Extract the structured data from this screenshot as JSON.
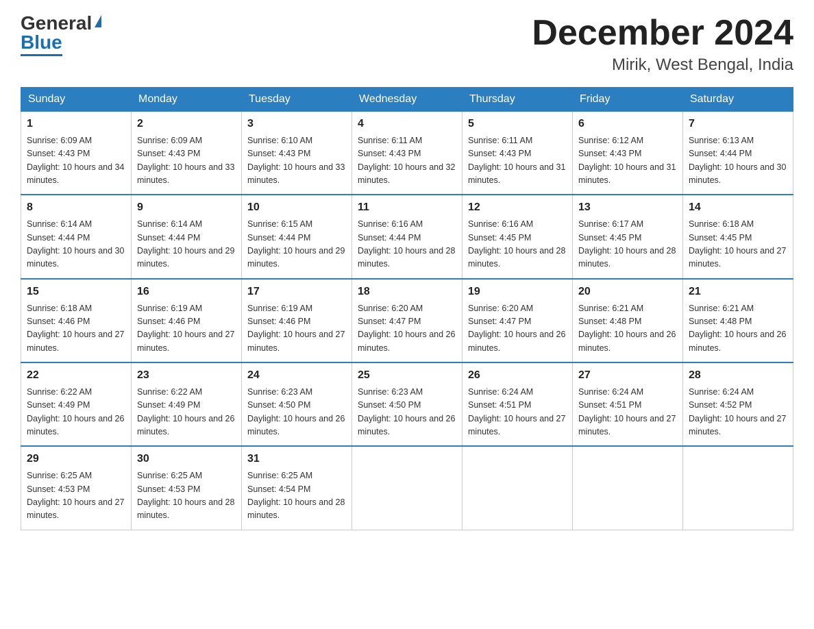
{
  "header": {
    "logo_general": "General",
    "logo_blue": "Blue",
    "month_title": "December 2024",
    "location": "Mirik, West Bengal, India"
  },
  "days_of_week": [
    "Sunday",
    "Monday",
    "Tuesday",
    "Wednesday",
    "Thursday",
    "Friday",
    "Saturday"
  ],
  "weeks": [
    [
      {
        "day": "1",
        "sunrise": "6:09 AM",
        "sunset": "4:43 PM",
        "daylight": "10 hours and 34 minutes."
      },
      {
        "day": "2",
        "sunrise": "6:09 AM",
        "sunset": "4:43 PM",
        "daylight": "10 hours and 33 minutes."
      },
      {
        "day": "3",
        "sunrise": "6:10 AM",
        "sunset": "4:43 PM",
        "daylight": "10 hours and 33 minutes."
      },
      {
        "day": "4",
        "sunrise": "6:11 AM",
        "sunset": "4:43 PM",
        "daylight": "10 hours and 32 minutes."
      },
      {
        "day": "5",
        "sunrise": "6:11 AM",
        "sunset": "4:43 PM",
        "daylight": "10 hours and 31 minutes."
      },
      {
        "day": "6",
        "sunrise": "6:12 AM",
        "sunset": "4:43 PM",
        "daylight": "10 hours and 31 minutes."
      },
      {
        "day": "7",
        "sunrise": "6:13 AM",
        "sunset": "4:44 PM",
        "daylight": "10 hours and 30 minutes."
      }
    ],
    [
      {
        "day": "8",
        "sunrise": "6:14 AM",
        "sunset": "4:44 PM",
        "daylight": "10 hours and 30 minutes."
      },
      {
        "day": "9",
        "sunrise": "6:14 AM",
        "sunset": "4:44 PM",
        "daylight": "10 hours and 29 minutes."
      },
      {
        "day": "10",
        "sunrise": "6:15 AM",
        "sunset": "4:44 PM",
        "daylight": "10 hours and 29 minutes."
      },
      {
        "day": "11",
        "sunrise": "6:16 AM",
        "sunset": "4:44 PM",
        "daylight": "10 hours and 28 minutes."
      },
      {
        "day": "12",
        "sunrise": "6:16 AM",
        "sunset": "4:45 PM",
        "daylight": "10 hours and 28 minutes."
      },
      {
        "day": "13",
        "sunrise": "6:17 AM",
        "sunset": "4:45 PM",
        "daylight": "10 hours and 28 minutes."
      },
      {
        "day": "14",
        "sunrise": "6:18 AM",
        "sunset": "4:45 PM",
        "daylight": "10 hours and 27 minutes."
      }
    ],
    [
      {
        "day": "15",
        "sunrise": "6:18 AM",
        "sunset": "4:46 PM",
        "daylight": "10 hours and 27 minutes."
      },
      {
        "day": "16",
        "sunrise": "6:19 AM",
        "sunset": "4:46 PM",
        "daylight": "10 hours and 27 minutes."
      },
      {
        "day": "17",
        "sunrise": "6:19 AM",
        "sunset": "4:46 PM",
        "daylight": "10 hours and 27 minutes."
      },
      {
        "day": "18",
        "sunrise": "6:20 AM",
        "sunset": "4:47 PM",
        "daylight": "10 hours and 26 minutes."
      },
      {
        "day": "19",
        "sunrise": "6:20 AM",
        "sunset": "4:47 PM",
        "daylight": "10 hours and 26 minutes."
      },
      {
        "day": "20",
        "sunrise": "6:21 AM",
        "sunset": "4:48 PM",
        "daylight": "10 hours and 26 minutes."
      },
      {
        "day": "21",
        "sunrise": "6:21 AM",
        "sunset": "4:48 PM",
        "daylight": "10 hours and 26 minutes."
      }
    ],
    [
      {
        "day": "22",
        "sunrise": "6:22 AM",
        "sunset": "4:49 PM",
        "daylight": "10 hours and 26 minutes."
      },
      {
        "day": "23",
        "sunrise": "6:22 AM",
        "sunset": "4:49 PM",
        "daylight": "10 hours and 26 minutes."
      },
      {
        "day": "24",
        "sunrise": "6:23 AM",
        "sunset": "4:50 PM",
        "daylight": "10 hours and 26 minutes."
      },
      {
        "day": "25",
        "sunrise": "6:23 AM",
        "sunset": "4:50 PM",
        "daylight": "10 hours and 26 minutes."
      },
      {
        "day": "26",
        "sunrise": "6:24 AM",
        "sunset": "4:51 PM",
        "daylight": "10 hours and 27 minutes."
      },
      {
        "day": "27",
        "sunrise": "6:24 AM",
        "sunset": "4:51 PM",
        "daylight": "10 hours and 27 minutes."
      },
      {
        "day": "28",
        "sunrise": "6:24 AM",
        "sunset": "4:52 PM",
        "daylight": "10 hours and 27 minutes."
      }
    ],
    [
      {
        "day": "29",
        "sunrise": "6:25 AM",
        "sunset": "4:53 PM",
        "daylight": "10 hours and 27 minutes."
      },
      {
        "day": "30",
        "sunrise": "6:25 AM",
        "sunset": "4:53 PM",
        "daylight": "10 hours and 28 minutes."
      },
      {
        "day": "31",
        "sunrise": "6:25 AM",
        "sunset": "4:54 PM",
        "daylight": "10 hours and 28 minutes."
      },
      null,
      null,
      null,
      null
    ]
  ],
  "labels": {
    "sunrise": "Sunrise:",
    "sunset": "Sunset:",
    "daylight": "Daylight:"
  }
}
